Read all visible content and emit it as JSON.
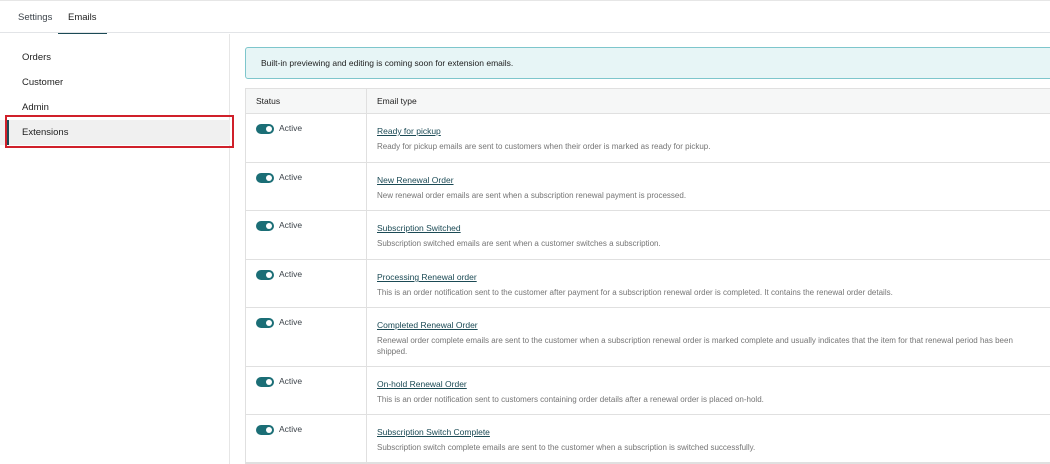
{
  "tabs": [
    {
      "label": "Settings",
      "active": false
    },
    {
      "label": "Emails",
      "active": true
    }
  ],
  "sidebar": {
    "items": [
      {
        "label": "Orders"
      },
      {
        "label": "Customer"
      },
      {
        "label": "Admin"
      },
      {
        "label": "Extensions",
        "selected": true
      }
    ]
  },
  "notice": {
    "text": "Built-in previewing and editing is coming soon for extension emails."
  },
  "table": {
    "headers": {
      "status": "Status",
      "type": "Email type"
    },
    "rows": [
      {
        "status": "Active",
        "title": "Ready for pickup",
        "description": "Ready for pickup emails are sent to customers when their order is marked as ready for pickup."
      },
      {
        "status": "Active",
        "title": "New Renewal Order",
        "description": "New renewal order emails are sent when a subscription renewal payment is processed."
      },
      {
        "status": "Active",
        "title": "Subscription Switched",
        "description": "Subscription switched emails are sent when a customer switches a subscription."
      },
      {
        "status": "Active",
        "title": "Processing Renewal order",
        "description": "This is an order notification sent to the customer after payment for a subscription renewal order is completed. It contains the renewal order details."
      },
      {
        "status": "Active",
        "title": "Completed Renewal Order",
        "description": "Renewal order complete emails are sent to the customer when a subscription renewal order is marked complete and usually indicates that the item for that renewal period has been shipped."
      },
      {
        "status": "Active",
        "title": "On-hold Renewal Order",
        "description": "This is an order notification sent to customers containing order details after a renewal order is placed on-hold."
      },
      {
        "status": "Active",
        "title": "Subscription Switch Complete",
        "description": "Subscription switch complete emails are sent to the customer when a subscription is switched successfully."
      }
    ]
  },
  "colors": {
    "accent": "#1b4a55",
    "toggle_on": "#1b6e76",
    "notice_bg": "#e7f5f6",
    "highlight": "#d0202a"
  }
}
